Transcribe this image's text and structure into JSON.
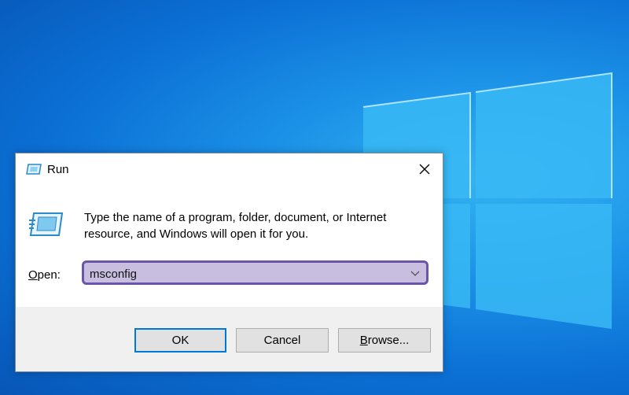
{
  "window": {
    "title": "Run",
    "close_glyph": "✕",
    "icon": "run-icon"
  },
  "dialog": {
    "description_line1": "Type the name of a program, folder, document, or Internet",
    "description_line2": "resource, and Windows will open it for you.",
    "open_label_mnemonic": "O",
    "open_label_rest": "pen:",
    "input_value": "msconfig",
    "dropdown_icon": "chevron-down-icon"
  },
  "buttons": {
    "ok": "OK",
    "cancel": "Cancel",
    "browse_mnemonic": "B",
    "browse_rest": "rowse..."
  },
  "colors": {
    "desktop": "#0b6fd4",
    "focus_border": "#0078d7",
    "highlight_border": "#6a55a8",
    "highlight_fill": "#c8bfe0"
  }
}
